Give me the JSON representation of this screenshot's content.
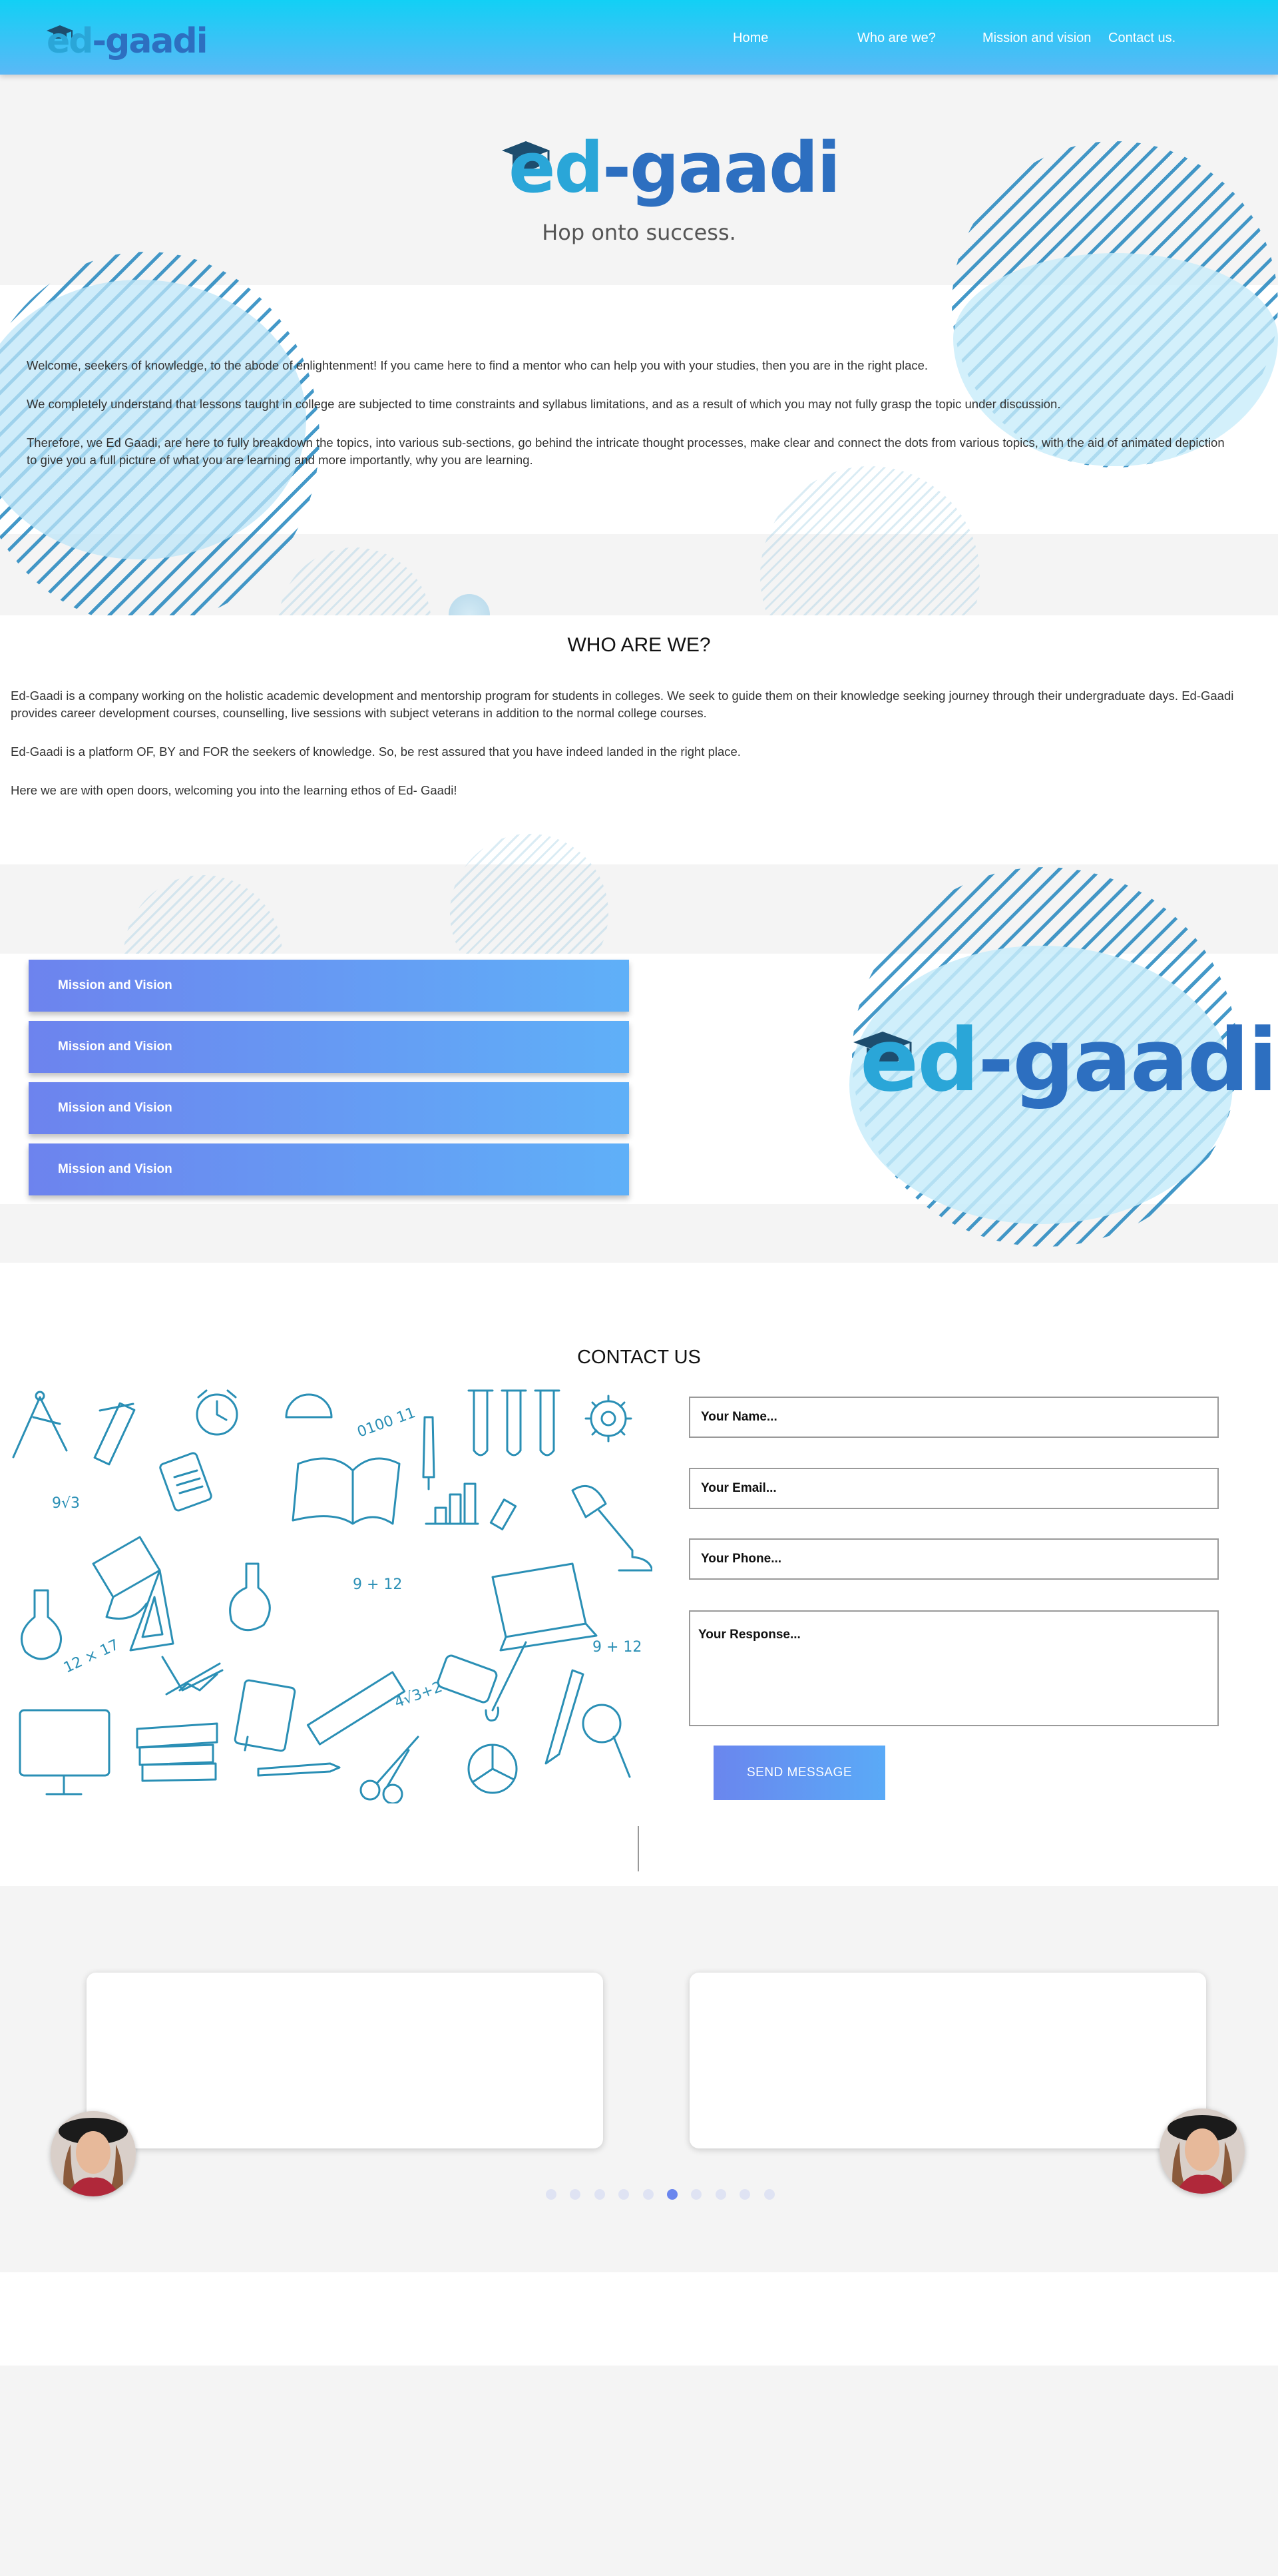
{
  "brand": {
    "logo_ed": "ed",
    "logo_dash": "-",
    "logo_gaadi": "gaadi"
  },
  "nav": {
    "items": [
      {
        "label": "Home"
      },
      {
        "label": "Who are we?"
      },
      {
        "label": "Mission and vision"
      },
      {
        "label": "Contact us."
      }
    ]
  },
  "hero": {
    "tagline": "Hop onto success."
  },
  "intro": {
    "paragraphs": [
      "Welcome, seekers of knowledge, to the abode of enlightenment! If you came here to find a mentor who can help you with your studies, then you are in the right place.",
      "We completely understand that lessons taught in college are subjected to time constraints and syllabus limitations, and as a result of which you may not fully grasp the topic under discussion.",
      "Therefore, we Ed Gaadi, are here to fully breakdown the topics, into various sub-sections, go behind the intricate thought processes, make clear and connect the dots from various topics, with the aid of animated depiction to give you a full picture of what you are learning and more importantly, why you are learning."
    ]
  },
  "who": {
    "heading": "WHO ARE WE?",
    "paragraphs": [
      "Ed-Gaadi is a company working on the holistic academic development and mentorship program for students in colleges. We seek to guide them on their knowledge seeking journey through their undergraduate days. Ed-Gaadi provides career development courses, counselling, live sessions with subject veterans in addition to the normal college courses.",
      "Ed-Gaadi is a platform OF, BY and FOR the seekers of knowledge. So, be rest assured that you have indeed landed in the right place.",
      "Here we are with open doors, welcoming you into the learning ethos of Ed- Gaadi!"
    ]
  },
  "mission": {
    "items": [
      {
        "label": "Mission and Vision"
      },
      {
        "label": "Mission and Vision"
      },
      {
        "label": "Mission and Vision"
      },
      {
        "label": "Mission and Vision"
      }
    ]
  },
  "contact": {
    "heading": "CONTACT US",
    "name_placeholder": "Your Name...",
    "email_placeholder": "Your Email...",
    "phone_placeholder": "Your Phone...",
    "response_placeholder": "Your Response...",
    "send_label": "SEND MESSAGE",
    "doodle_texts": [
      "0100 11",
      "9√3",
      "9 + 12",
      "12 × 17",
      "4√3+2",
      "9 + 12"
    ]
  },
  "testimonials": {
    "dots": 10,
    "active_dot": 5
  },
  "colors": {
    "nav_top": "#12d0f5",
    "nav_bottom": "#5ab8f6",
    "accent_blue": "#2d6fc0",
    "accent_cyan": "#2aa6d8",
    "button_gradient_start": "#6a86ee",
    "button_gradient_end": "#5aaaf7"
  }
}
